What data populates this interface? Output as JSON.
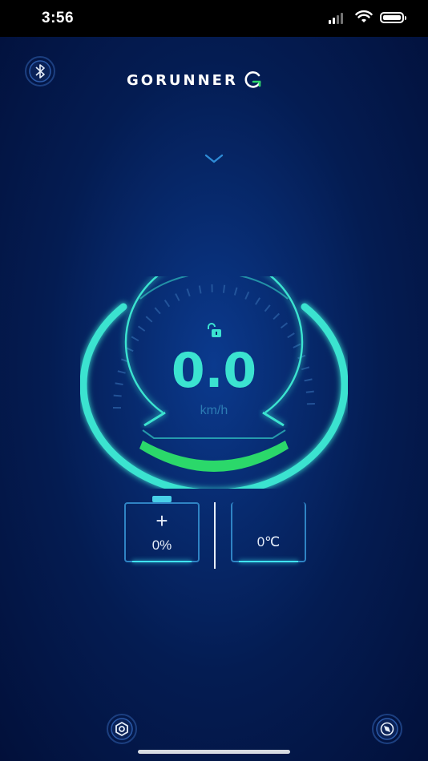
{
  "status_bar": {
    "time": "3:56"
  },
  "header": {
    "brand": "GORUNNER"
  },
  "speedometer": {
    "speed": "0.0",
    "unit": "km/h"
  },
  "battery": {
    "label_symbol": "+",
    "value": "0%"
  },
  "temperature": {
    "value": "0℃"
  },
  "icons": {
    "bluetooth": "bluetooth-icon",
    "chevron": "chevron-down-icon",
    "lock": "unlock-icon",
    "settings": "gear-icon",
    "compass": "compass-icon"
  },
  "colors": {
    "accent_cyan": "#3be3d0",
    "gauge_green": "#2bd86a",
    "background": "#041c52"
  }
}
